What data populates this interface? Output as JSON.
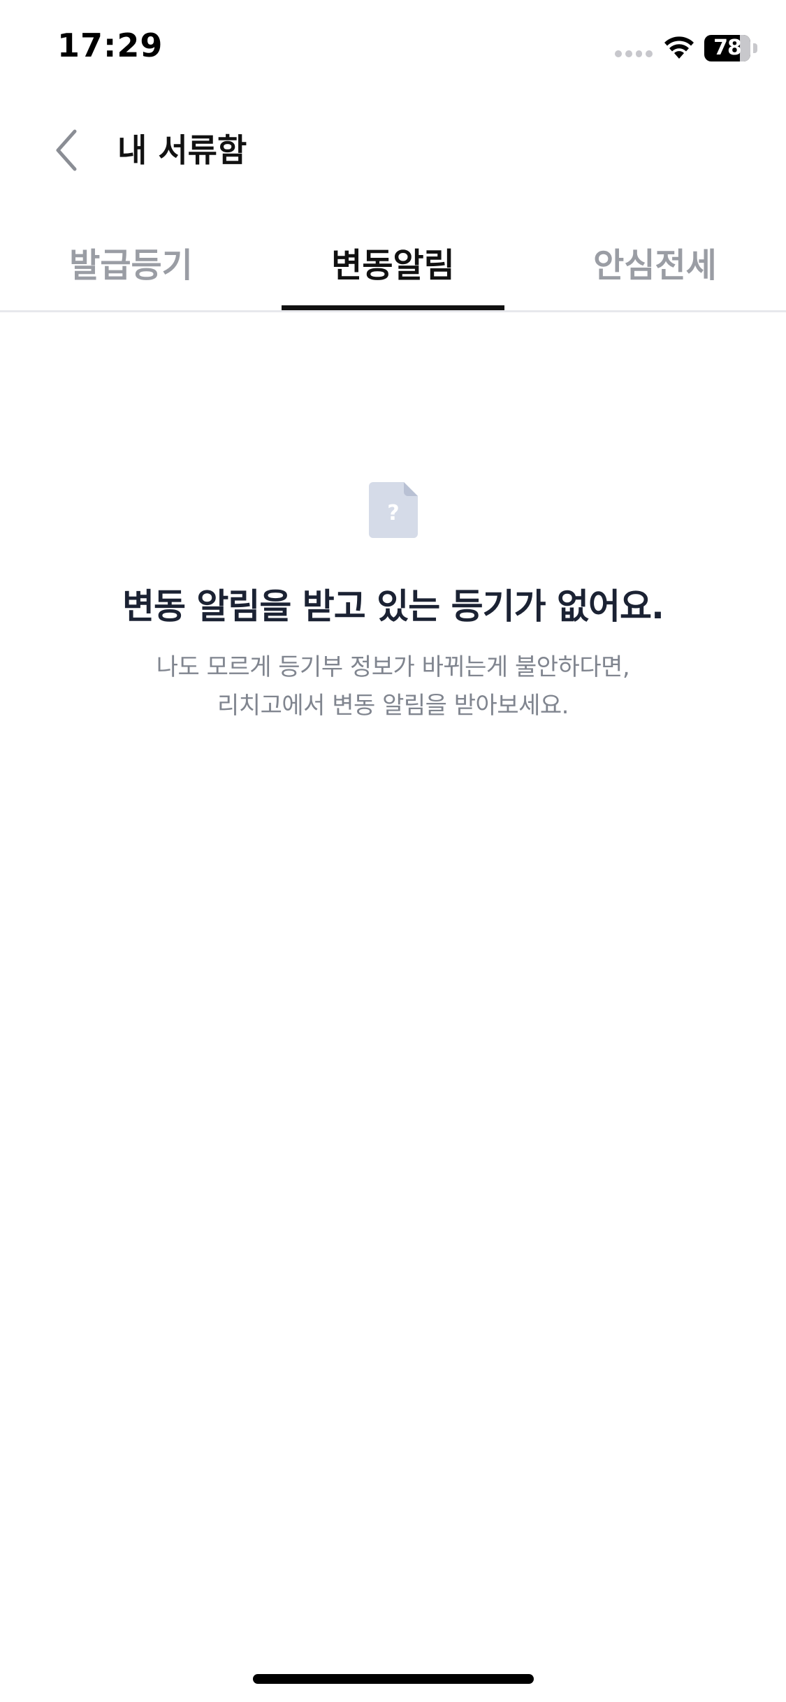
{
  "status_bar": {
    "time": "17:29",
    "battery_level": "78",
    "battery_percent": 78
  },
  "header": {
    "back_icon": "chevron-left-icon",
    "title": "내 서류함"
  },
  "tabs": [
    {
      "label": "발급등기",
      "active": false
    },
    {
      "label": "변동알림",
      "active": true
    },
    {
      "label": "안심전세",
      "active": false
    }
  ],
  "empty_state": {
    "icon": "document-question-icon",
    "title": "변동 알림을 받고 있는 등기가 없어요.",
    "description_line1": "나도 모르게 등기부 정보가 바뀌는게 불안하다면,",
    "description_line2": "리치고에서 변동 알림을 받아보세요."
  },
  "colors": {
    "active_tab": "#111111",
    "inactive_tab": "#9a9da4",
    "icon_fill": "#d5dbe8",
    "title_text": "#1b2233",
    "description_text": "#80858f"
  }
}
